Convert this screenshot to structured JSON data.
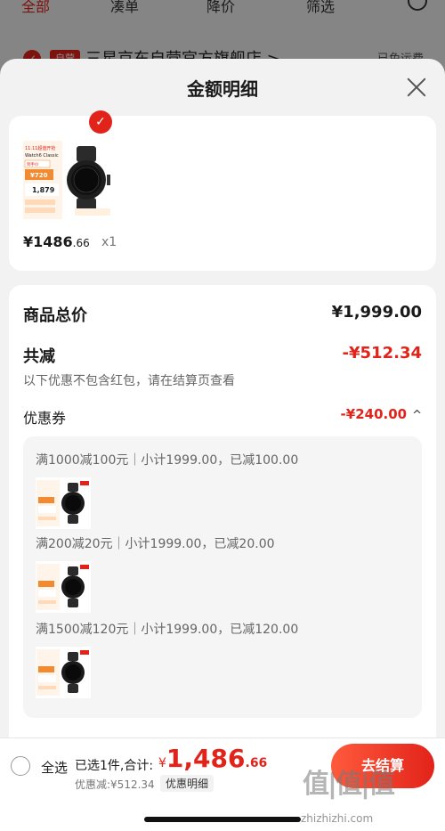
{
  "background": {
    "tabs": [
      "全部",
      "凑单",
      "降价",
      "筛选"
    ],
    "store_name": "三星京东自营官方旗舰店 >",
    "store_badge": "自营",
    "shipping": "已免运费"
  },
  "sheet": {
    "title": "金额明细",
    "product": {
      "price_main": "¥1486",
      "price_decimal": ".66",
      "quantity": "x1",
      "image_text": {
        "line1": "11.11超值开抢",
        "line2": "Watch6 Classic",
        "line3": "到手价",
        "line4": "¥720",
        "line5": "1,879"
      }
    },
    "summary": {
      "total_label": "商品总价",
      "total_value": "¥1,999.00",
      "reduce_label": "共减",
      "reduce_value": "-¥512.34",
      "note": "以下优惠不包含红包，请在结算页查看",
      "coupon_label": "优惠券",
      "coupon_value": "-¥240.00",
      "coupon_toggle": "^"
    },
    "coupons": [
      {
        "text": "满1000减100元｜小计1999.00，已减100.00"
      },
      {
        "text": "满200减20元｜小计1999.00，已减20.00"
      },
      {
        "text": "满1500减120元｜小计1999.00，已减120.00"
      }
    ]
  },
  "bottom": {
    "select_all": "全选",
    "selected_text": "已选1件,合计:",
    "currency": "¥",
    "total_int": "1,486",
    "total_dec": ".66",
    "discount_text": "优惠减:¥512.34",
    "detail_tag": "优惠明细",
    "checkout": "去结算"
  },
  "watermark": {
    "text": "值|值|值",
    "url": "zhizhizhi.com"
  },
  "colors": {
    "accent": "#e2231a",
    "background": "#f2f2f2"
  }
}
